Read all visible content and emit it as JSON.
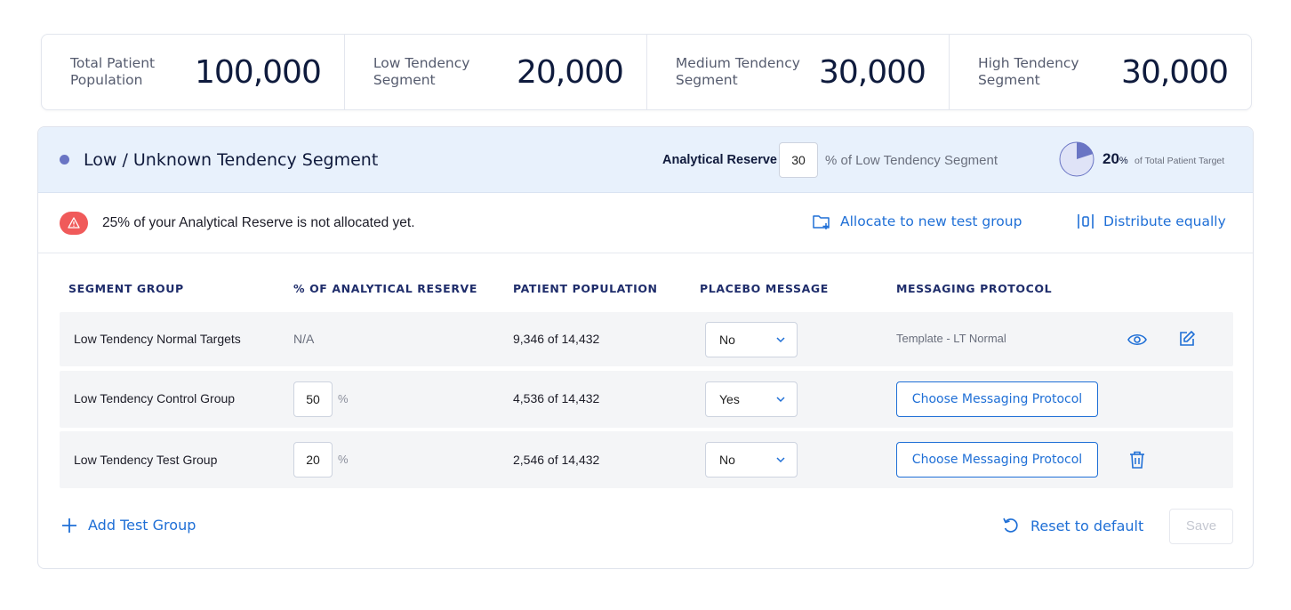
{
  "stats": [
    {
      "label": "Total Patient Population",
      "value": "100,000"
    },
    {
      "label": "Low Tendency Segment",
      "value": "20,000"
    },
    {
      "label": "Medium Tendency Segment",
      "value": "30,000"
    },
    {
      "label": "High Tendency Segment",
      "value": "30,000"
    }
  ],
  "segment": {
    "title": "Low / Unknown Tendency Segment",
    "reserve_label": "Analytical Reserve",
    "reserve_value": "30",
    "reserve_suffix": "% of Low Tendency Segment",
    "target_pct": "20",
    "target_pct_sign": "%",
    "target_sub": "of Total Patient Target",
    "target_fraction": 0.2
  },
  "alert": {
    "text": "25% of your Analytical Reserve is not allocated yet.",
    "allocate_label": "Allocate to new test group",
    "distribute_label": "Distribute equally"
  },
  "table": {
    "headers": [
      "SEGMENT GROUP",
      "% OF ANALYTICAL RESERVE",
      "PATIENT POPULATION",
      "PLACEBO MESSAGE",
      "MESSAGING PROTOCOL"
    ],
    "rows": [
      {
        "group": "Low Tendency Normal Targets",
        "reserve": "N/A",
        "population": "9,346 of 14,432",
        "placebo": "No",
        "protocol": "Template - LT Normal"
      },
      {
        "group": "Low Tendency Control Group",
        "reserve": "50",
        "reserve_suffix": "%",
        "population": "4,536 of 14,432",
        "placebo": "Yes",
        "protocol_button": "Choose Messaging Protocol"
      },
      {
        "group": "Low Tendency Test Group",
        "reserve": "20",
        "reserve_suffix": "%",
        "population": "2,546 of 14,432",
        "placebo": "No",
        "protocol_button": "Choose Messaging Protocol"
      }
    ]
  },
  "footer": {
    "add_label": "Add Test Group",
    "reset_label": "Reset to default",
    "save_label": "Save"
  },
  "colors": {
    "accent": "#1f6fd6",
    "header_bg": "#e8f1fc",
    "alert": "#f05a5a",
    "dot": "#6a75c4"
  }
}
